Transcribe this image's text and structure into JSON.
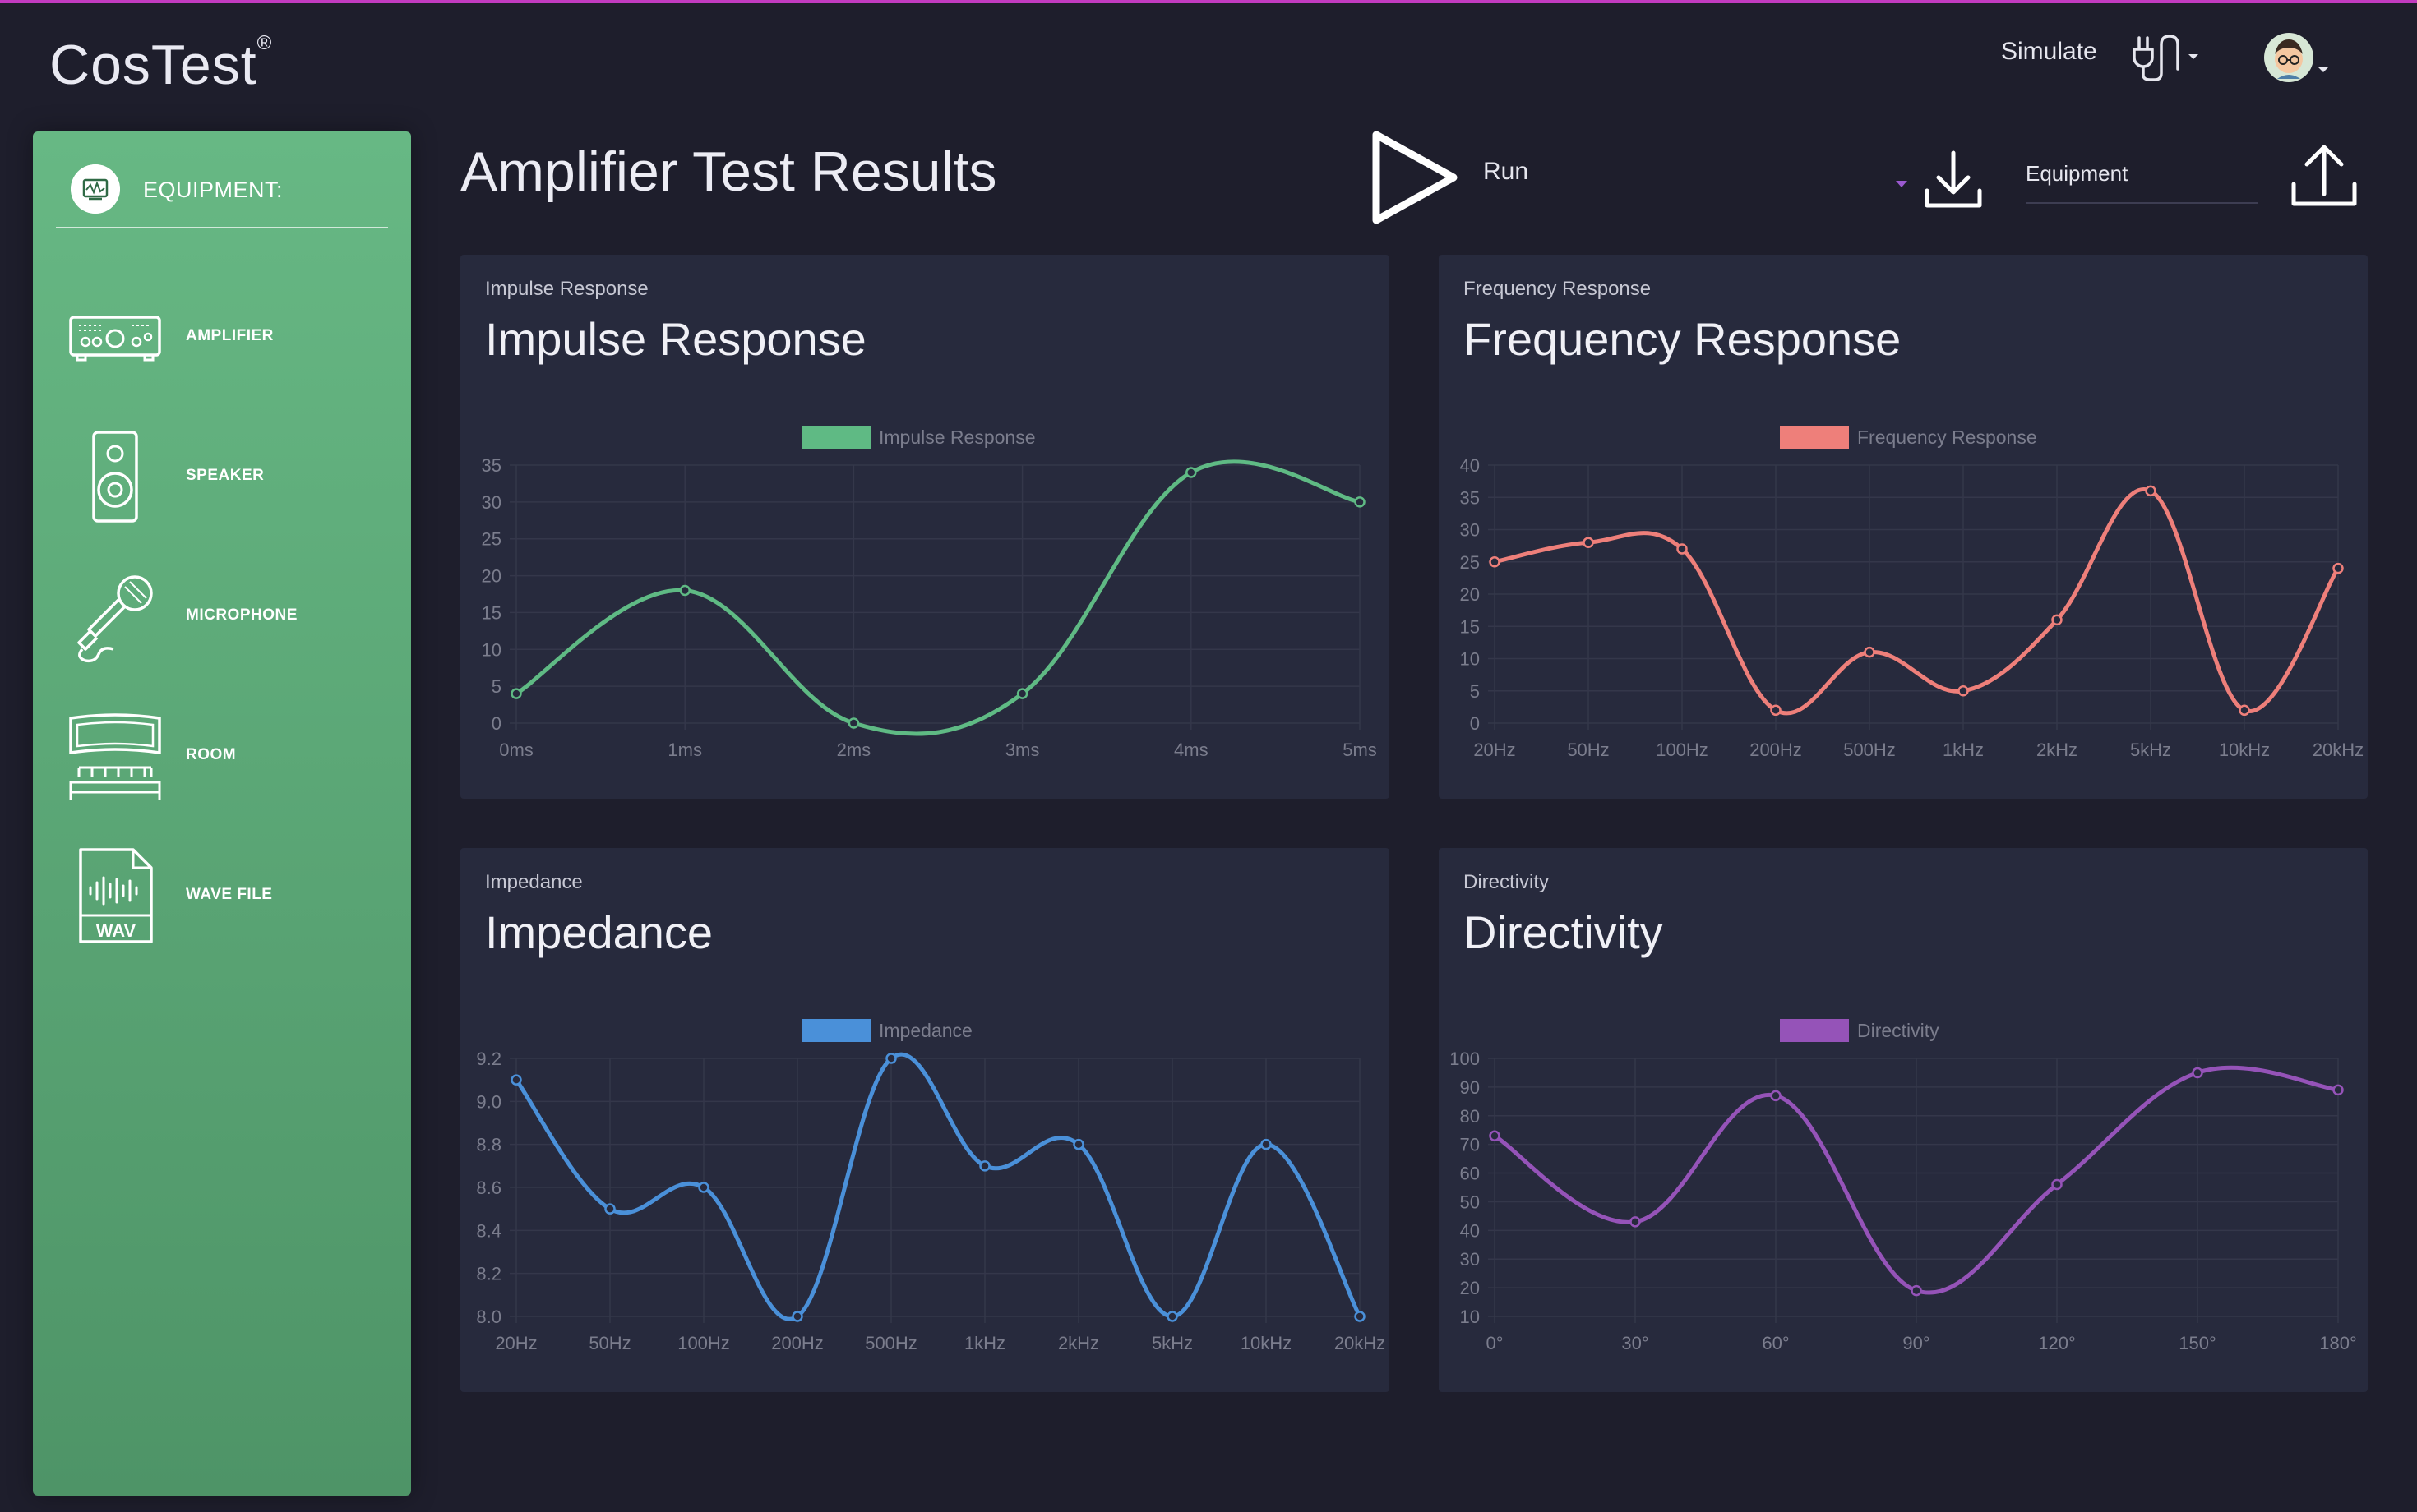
{
  "app": {
    "brand": "CosTest",
    "registered": "®"
  },
  "topbar": {
    "simulate_label": "Simulate"
  },
  "sidebar": {
    "title": "EQUIPMENT:",
    "items": [
      {
        "label": "AMPLIFIER",
        "icon": "amplifier-icon"
      },
      {
        "label": "SPEAKER",
        "icon": "speaker-icon"
      },
      {
        "label": "MICROPHONE",
        "icon": "microphone-icon"
      },
      {
        "label": "ROOM",
        "icon": "room-icon"
      },
      {
        "label": "WAVE FILE",
        "icon": "wav-file-icon"
      }
    ]
  },
  "header": {
    "title": "Amplifier Test Results",
    "run_label": "Run",
    "equipment_field": "Equipment"
  },
  "colors": {
    "impulse": "#5fba84",
    "frequency": "#ee7f7a",
    "impedance": "#4a90d9",
    "directivity": "#9553b8"
  },
  "chart_data": [
    {
      "type": "line",
      "subtitle": "Impulse Response",
      "title": "Impulse Response",
      "categories": [
        "0ms",
        "1ms",
        "2ms",
        "3ms",
        "4ms",
        "5ms"
      ],
      "series": [
        {
          "name": "Impulse Response",
          "values": [
            4,
            18,
            0,
            4,
            34,
            30
          ]
        }
      ],
      "ylim": [
        0,
        35
      ],
      "yticks": [
        "0",
        "5",
        "10",
        "15",
        "20",
        "25",
        "30",
        "35"
      ],
      "grid": true,
      "legend": "top-center"
    },
    {
      "type": "line",
      "subtitle": "Frequency Response",
      "title": "Frequency Response",
      "categories": [
        "20Hz",
        "50Hz",
        "100Hz",
        "200Hz",
        "500Hz",
        "1kHz",
        "2kHz",
        "5kHz",
        "10kHz",
        "20kHz"
      ],
      "series": [
        {
          "name": "Frequency Response",
          "values": [
            25,
            28,
            27,
            2,
            11,
            5,
            16,
            36,
            2,
            24
          ]
        }
      ],
      "ylim": [
        0,
        40
      ],
      "yticks": [
        "0",
        "5",
        "10",
        "15",
        "20",
        "25",
        "30",
        "35",
        "40"
      ],
      "grid": true,
      "legend": "top-center"
    },
    {
      "type": "line",
      "subtitle": "Impedance",
      "title": "Impedance",
      "categories": [
        "20Hz",
        "50Hz",
        "100Hz",
        "200Hz",
        "500Hz",
        "1kHz",
        "2kHz",
        "5kHz",
        "10kHz",
        "20kHz"
      ],
      "series": [
        {
          "name": "Impedance",
          "values": [
            9.1,
            8.5,
            8.6,
            8.0,
            9.2,
            8.7,
            8.8,
            8.0,
            8.8,
            8.0
          ]
        }
      ],
      "ylim": [
        8.0,
        9.2
      ],
      "yticks": [
        "8.0",
        "8.2",
        "8.4",
        "8.6",
        "8.8",
        "9.0",
        "9.2"
      ],
      "grid": true,
      "legend": "top-center"
    },
    {
      "type": "line",
      "subtitle": "Directivity",
      "title": "Directivity",
      "categories": [
        "0°",
        "30°",
        "60°",
        "90°",
        "120°",
        "150°",
        "180°"
      ],
      "series": [
        {
          "name": "Directivity",
          "values": [
            73,
            43,
            87,
            19,
            56,
            95,
            89
          ]
        }
      ],
      "ylim": [
        10,
        100
      ],
      "yticks": [
        "10",
        "20",
        "30",
        "40",
        "50",
        "60",
        "70",
        "80",
        "90",
        "100"
      ],
      "grid": true,
      "legend": "top-center"
    }
  ]
}
